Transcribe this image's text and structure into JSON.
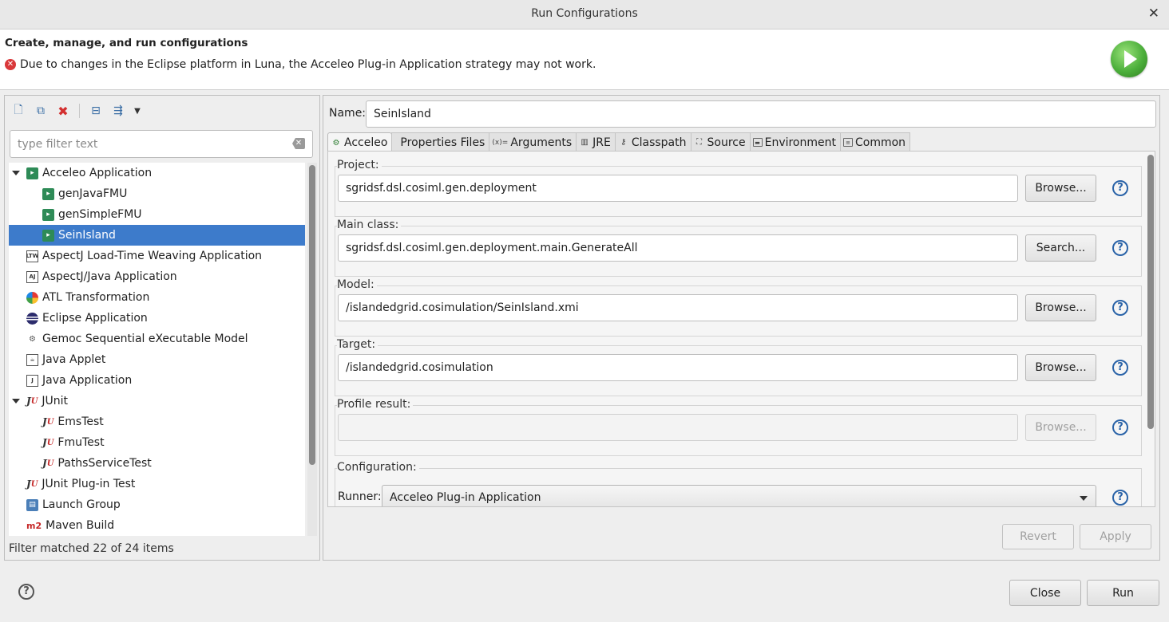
{
  "window": {
    "title": "Run Configurations",
    "close_glyph": "✕"
  },
  "banner": {
    "heading": "Create, manage, and run configurations",
    "message": "Due to changes in the Eclipse platform in Luna, the Acceleo Plug-in Application strategy may not work.",
    "message_icon": "error-icon",
    "badge_icon": "run-icon"
  },
  "left": {
    "toolbar": [
      "new-config-icon",
      "duplicate-icon",
      "delete-icon",
      "collapse-all-icon",
      "filter-icon",
      "dropdown-icon"
    ],
    "filter_placeholder": "type filter text",
    "tree": [
      {
        "label": "Acceleo Application",
        "level": 0,
        "expanded": true,
        "icon": "acceleo-icon"
      },
      {
        "label": "genJavaFMU",
        "level": 1,
        "icon": "acceleo-icon"
      },
      {
        "label": "genSimpleFMU",
        "level": 1,
        "icon": "acceleo-icon"
      },
      {
        "label": "SeinIsland",
        "level": 1,
        "icon": "acceleo-icon",
        "selected": true
      },
      {
        "label": "AspectJ Load-Time Weaving Application",
        "level": 0,
        "icon": "ltw-icon"
      },
      {
        "label": "AspectJ/Java Application",
        "level": 0,
        "icon": "aj-icon"
      },
      {
        "label": "ATL Transformation",
        "level": 0,
        "icon": "atl-icon"
      },
      {
        "label": "Eclipse Application",
        "level": 0,
        "icon": "eclipse-icon"
      },
      {
        "label": "Gemoc Sequential eXecutable Model",
        "level": 0,
        "icon": "gemoc-icon"
      },
      {
        "label": "Java Applet",
        "level": 0,
        "icon": "applet-icon"
      },
      {
        "label": "Java Application",
        "level": 0,
        "icon": "java-app-icon"
      },
      {
        "label": "JUnit",
        "level": 0,
        "expanded": true,
        "icon": "junit-icon"
      },
      {
        "label": "EmsTest",
        "level": 1,
        "icon": "junit-icon"
      },
      {
        "label": "FmuTest",
        "level": 1,
        "icon": "junit-icon"
      },
      {
        "label": "PathsServiceTest",
        "level": 1,
        "icon": "junit-icon"
      },
      {
        "label": "JUnit Plug-in Test",
        "level": 0,
        "icon": "junit-plugin-icon"
      },
      {
        "label": "Launch Group",
        "level": 0,
        "icon": "launch-group-icon"
      },
      {
        "label": "Maven Build",
        "level": 0,
        "icon": "maven-icon"
      }
    ],
    "status": "Filter matched 22 of 24 items"
  },
  "right": {
    "name_label": "Name:",
    "name_value": "SeinIsland",
    "tabs": [
      {
        "label": "Acceleo",
        "icon": "acceleo-gear-icon",
        "active": true
      },
      {
        "label": "Properties Files",
        "icon": "",
        "active": false
      },
      {
        "label": "Arguments",
        "icon": "arguments-icon",
        "active": false
      },
      {
        "label": "JRE",
        "icon": "jre-icon",
        "active": false
      },
      {
        "label": "Classpath",
        "icon": "classpath-icon",
        "active": false
      },
      {
        "label": "Source",
        "icon": "source-icon",
        "active": false
      },
      {
        "label": "Environment",
        "icon": "environment-icon",
        "active": false
      },
      {
        "label": "Common",
        "icon": "common-icon",
        "active": false
      }
    ],
    "groups": [
      {
        "label": "Project:",
        "value": "sgridsf.dsl.cosiml.gen.deployment",
        "button": "Browse...",
        "enabled": true
      },
      {
        "label": "Main class:",
        "value": "sgridsf.dsl.cosiml.gen.deployment.main.GenerateAll",
        "button": "Search...",
        "enabled": true
      },
      {
        "label": "Model:",
        "value": "/islandedgrid.cosimulation/SeinIsland.xmi",
        "button": "Browse...",
        "enabled": true
      },
      {
        "label": "Target:",
        "value": "/islandedgrid.cosimulation",
        "button": "Browse...",
        "enabled": true
      },
      {
        "label": "Profile result:",
        "value": "",
        "button": "Browse...",
        "enabled": false
      }
    ],
    "configuration": {
      "label": "Configuration:",
      "runner_label": "Runner:",
      "runner_value": "Acceleo Plug-in Application"
    },
    "revert_label": "Revert",
    "apply_label": "Apply"
  },
  "footer": {
    "close_label": "Close",
    "run_label": "Run",
    "help_icon": "help-icon"
  }
}
